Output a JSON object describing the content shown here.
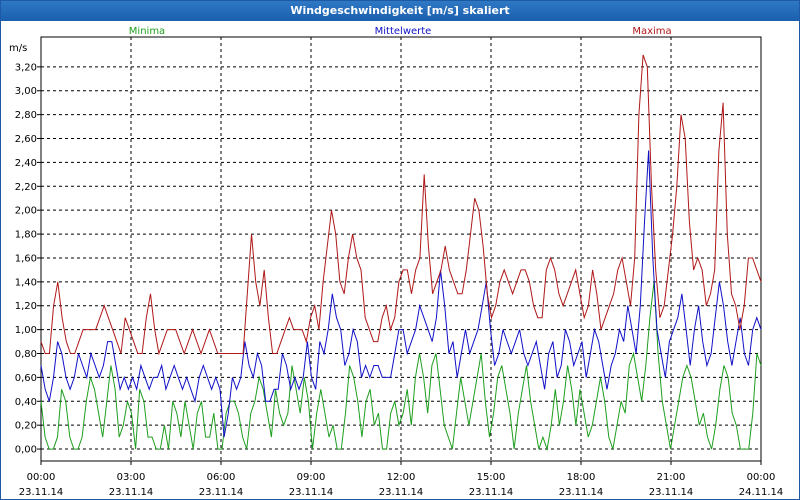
{
  "window": {
    "title": "Windgeschwindigkeit [m/s] skaliert"
  },
  "chart_data": {
    "type": "line",
    "title": "Windgeschwindigkeit [m/s] skaliert",
    "ylabel": "m/s",
    "xlabel": "",
    "ylim": [
      -0.1,
      3.45
    ],
    "yticks": [
      "0,00",
      "0,20",
      "0,40",
      "0,60",
      "0,80",
      "1,00",
      "1,20",
      "1,40",
      "1,60",
      "1,80",
      "2,00",
      "2,20",
      "2,40",
      "2,60",
      "2,80",
      "3,00",
      "3,20"
    ],
    "xticks": [
      {
        "time": "00:00",
        "date": "23.11.14"
      },
      {
        "time": "03:00",
        "date": "23.11.14"
      },
      {
        "time": "06:00",
        "date": "23.11.14"
      },
      {
        "time": "09:00",
        "date": "23.11.14"
      },
      {
        "time": "12:00",
        "date": "23.11.14"
      },
      {
        "time": "15:00",
        "date": "23.11.14"
      },
      {
        "time": "18:00",
        "date": "23.11.14"
      },
      {
        "time": "21:00",
        "date": "23.11.14"
      },
      {
        "time": "00:00",
        "date": "24.11.14"
      }
    ],
    "grid": true,
    "legend": "top",
    "series": [
      {
        "name": "Minima",
        "color": "#1e9e1e",
        "values": [
          0.4,
          0.1,
          0.0,
          0.0,
          0.1,
          0.5,
          0.4,
          0.1,
          0.0,
          0.0,
          0.1,
          0.4,
          0.6,
          0.5,
          0.3,
          0.1,
          0.4,
          0.7,
          0.5,
          0.1,
          0.2,
          0.4,
          0.3,
          0.0,
          0.5,
          0.4,
          0.1,
          0.1,
          0.0,
          0.0,
          0.2,
          0.0,
          0.4,
          0.3,
          0.1,
          0.4,
          0.2,
          0.0,
          0.3,
          0.4,
          0.1,
          0.1,
          0.3,
          0.0,
          0.0,
          0.3,
          0.4,
          0.4,
          0.3,
          0.1,
          0.0,
          0.3,
          0.4,
          0.6,
          0.5,
          0.3,
          0.1,
          0.5,
          0.3,
          0.2,
          0.3,
          0.7,
          0.5,
          0.3,
          0.6,
          0.4,
          0.0,
          0.3,
          0.5,
          0.3,
          0.1,
          0.2,
          0.0,
          0.0,
          0.3,
          0.7,
          0.6,
          0.4,
          0.1,
          0.4,
          0.5,
          0.2,
          0.3,
          0.0,
          0.0,
          0.3,
          0.4,
          0.2,
          0.3,
          0.5,
          0.2,
          0.6,
          0.8,
          0.6,
          0.3,
          0.7,
          0.8,
          0.5,
          0.2,
          0.1,
          0.0,
          0.3,
          0.6,
          0.4,
          0.2,
          0.4,
          0.6,
          0.8,
          0.4,
          0.1,
          0.3,
          0.6,
          0.7,
          0.5,
          0.3,
          0.0,
          0.3,
          0.5,
          0.7,
          0.4,
          0.2,
          0.0,
          0.1,
          0.0,
          0.2,
          0.5,
          0.2,
          0.4,
          0.7,
          0.5,
          0.2,
          0.5,
          0.3,
          0.1,
          0.2,
          0.4,
          0.6,
          0.4,
          0.1,
          0.0,
          0.2,
          0.4,
          0.3,
          0.7,
          0.8,
          0.6,
          0.4,
          0.7,
          1.1,
          1.4,
          0.8,
          0.4,
          0.2,
          0.0,
          0.2,
          0.4,
          0.6,
          0.7,
          0.6,
          0.4,
          0.2,
          0.3,
          0.1,
          0.0,
          0.2,
          0.5,
          0.7,
          0.6,
          0.3,
          0.2,
          0.0,
          0.0,
          0.0,
          0.3,
          0.8,
          0.7
        ]
      },
      {
        "name": "Mittelwerte",
        "color": "#1010c8",
        "values": [
          0.7,
          0.5,
          0.4,
          0.6,
          0.9,
          0.8,
          0.6,
          0.5,
          0.6,
          0.8,
          0.7,
          0.6,
          0.8,
          0.7,
          0.6,
          0.7,
          0.9,
          0.9,
          0.7,
          0.5,
          0.6,
          0.5,
          0.6,
          0.5,
          0.7,
          0.6,
          0.5,
          0.6,
          0.6,
          0.7,
          0.5,
          0.6,
          0.7,
          0.6,
          0.5,
          0.6,
          0.5,
          0.4,
          0.6,
          0.7,
          0.6,
          0.5,
          0.6,
          0.5,
          0.1,
          0.3,
          0.6,
          0.5,
          0.6,
          0.9,
          0.7,
          0.6,
          0.8,
          0.7,
          0.4,
          0.4,
          0.5,
          0.5,
          0.8,
          0.7,
          0.5,
          0.6,
          0.5,
          0.6,
          0.9,
          0.6,
          0.5,
          0.9,
          0.8,
          1.0,
          1.3,
          1.1,
          1.0,
          0.7,
          0.8,
          1.0,
          0.9,
          0.6,
          0.7,
          0.6,
          0.7,
          0.7,
          0.6,
          0.6,
          0.6,
          0.8,
          1.0,
          1.0,
          0.8,
          0.9,
          1.0,
          1.2,
          1.1,
          1.0,
          0.9,
          1.1,
          1.5,
          1.2,
          0.8,
          0.9,
          0.6,
          0.8,
          1.0,
          0.8,
          0.9,
          1.0,
          1.2,
          1.4,
          1.0,
          0.7,
          0.8,
          1.0,
          0.9,
          0.8,
          0.9,
          1.0,
          0.8,
          0.7,
          0.8,
          0.9,
          0.7,
          0.5,
          0.8,
          0.9,
          0.6,
          0.7,
          1.0,
          0.9,
          0.7,
          0.8,
          0.9,
          0.6,
          0.8,
          1.0,
          0.9,
          0.7,
          0.5,
          0.7,
          0.8,
          1.0,
          0.9,
          1.2,
          1.0,
          0.8,
          1.2,
          1.9,
          2.5,
          1.6,
          1.0,
          0.8,
          0.6,
          0.9,
          1.0,
          1.1,
          1.3,
          1.0,
          0.7,
          1.0,
          1.2,
          0.9,
          0.7,
          0.8,
          1.1,
          1.4,
          1.2,
          0.9,
          0.7,
          0.9,
          1.1,
          0.8,
          0.7,
          1.0,
          1.1,
          1.0
        ]
      },
      {
        "name": "Maxima",
        "color": "#b01818",
        "values": [
          0.9,
          0.8,
          0.8,
          1.2,
          1.4,
          1.1,
          0.9,
          0.8,
          0.8,
          0.9,
          1.0,
          1.0,
          1.0,
          1.0,
          1.1,
          1.2,
          1.1,
          1.0,
          0.9,
          0.8,
          1.1,
          1.0,
          0.9,
          0.8,
          0.8,
          1.1,
          1.3,
          1.0,
          0.8,
          0.9,
          1.0,
          1.0,
          1.0,
          0.9,
          0.8,
          0.9,
          1.0,
          0.9,
          0.8,
          0.9,
          1.0,
          0.9,
          0.8,
          0.8,
          0.8,
          0.8,
          0.8,
          0.8,
          0.8,
          1.3,
          1.8,
          1.4,
          1.2,
          1.5,
          1.1,
          0.8,
          0.8,
          0.9,
          1.0,
          1.1,
          1.0,
          1.0,
          1.0,
          0.9,
          1.1,
          1.2,
          1.0,
          1.4,
          1.7,
          2.0,
          1.8,
          1.4,
          1.3,
          1.6,
          1.8,
          1.6,
          1.5,
          1.1,
          1.0,
          0.9,
          0.9,
          1.1,
          1.2,
          1.0,
          1.1,
          1.4,
          1.5,
          1.5,
          1.3,
          1.5,
          1.6,
          2.3,
          1.7,
          1.3,
          1.4,
          1.5,
          1.7,
          1.5,
          1.4,
          1.3,
          1.3,
          1.5,
          1.8,
          2.1,
          2.0,
          1.7,
          1.3,
          1.1,
          1.2,
          1.4,
          1.5,
          1.4,
          1.3,
          1.4,
          1.5,
          1.5,
          1.4,
          1.2,
          1.1,
          1.1,
          1.5,
          1.6,
          1.5,
          1.3,
          1.2,
          1.3,
          1.4,
          1.5,
          1.3,
          1.1,
          1.2,
          1.5,
          1.3,
          1.0,
          1.1,
          1.2,
          1.3,
          1.5,
          1.6,
          1.4,
          1.2,
          1.6,
          2.8,
          3.3,
          3.2,
          2.2,
          1.5,
          1.1,
          1.2,
          1.5,
          1.8,
          2.2,
          2.8,
          2.6,
          1.9,
          1.5,
          1.6,
          1.5,
          1.2,
          1.3,
          1.5,
          2.5,
          2.9,
          1.8,
          1.3,
          1.2,
          1.0,
          1.2,
          1.6,
          1.6,
          1.5,
          1.4
        ]
      }
    ]
  }
}
